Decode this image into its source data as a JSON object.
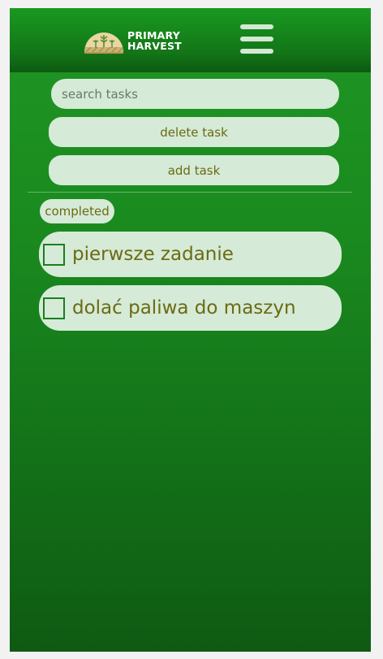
{
  "header": {
    "logo_line1": "PRIMARY",
    "logo_line2": "HARVEST",
    "menu_icon": "hamburger-menu-icon"
  },
  "search": {
    "placeholder": "search tasks",
    "value": ""
  },
  "buttons": {
    "delete_label": "delete task",
    "add_label": "add task"
  },
  "filter": {
    "completed_label": "completed"
  },
  "tasks": [
    {
      "label": "pierwsze zadanie",
      "checked": false
    },
    {
      "label": "dolać paliwa do maszyn",
      "checked": false
    }
  ],
  "colors": {
    "brand_green": "#1a8a1f",
    "dark_green": "#0f5a13",
    "pill_bg": "#d5ead7",
    "text_olive": "#6b6b12"
  }
}
